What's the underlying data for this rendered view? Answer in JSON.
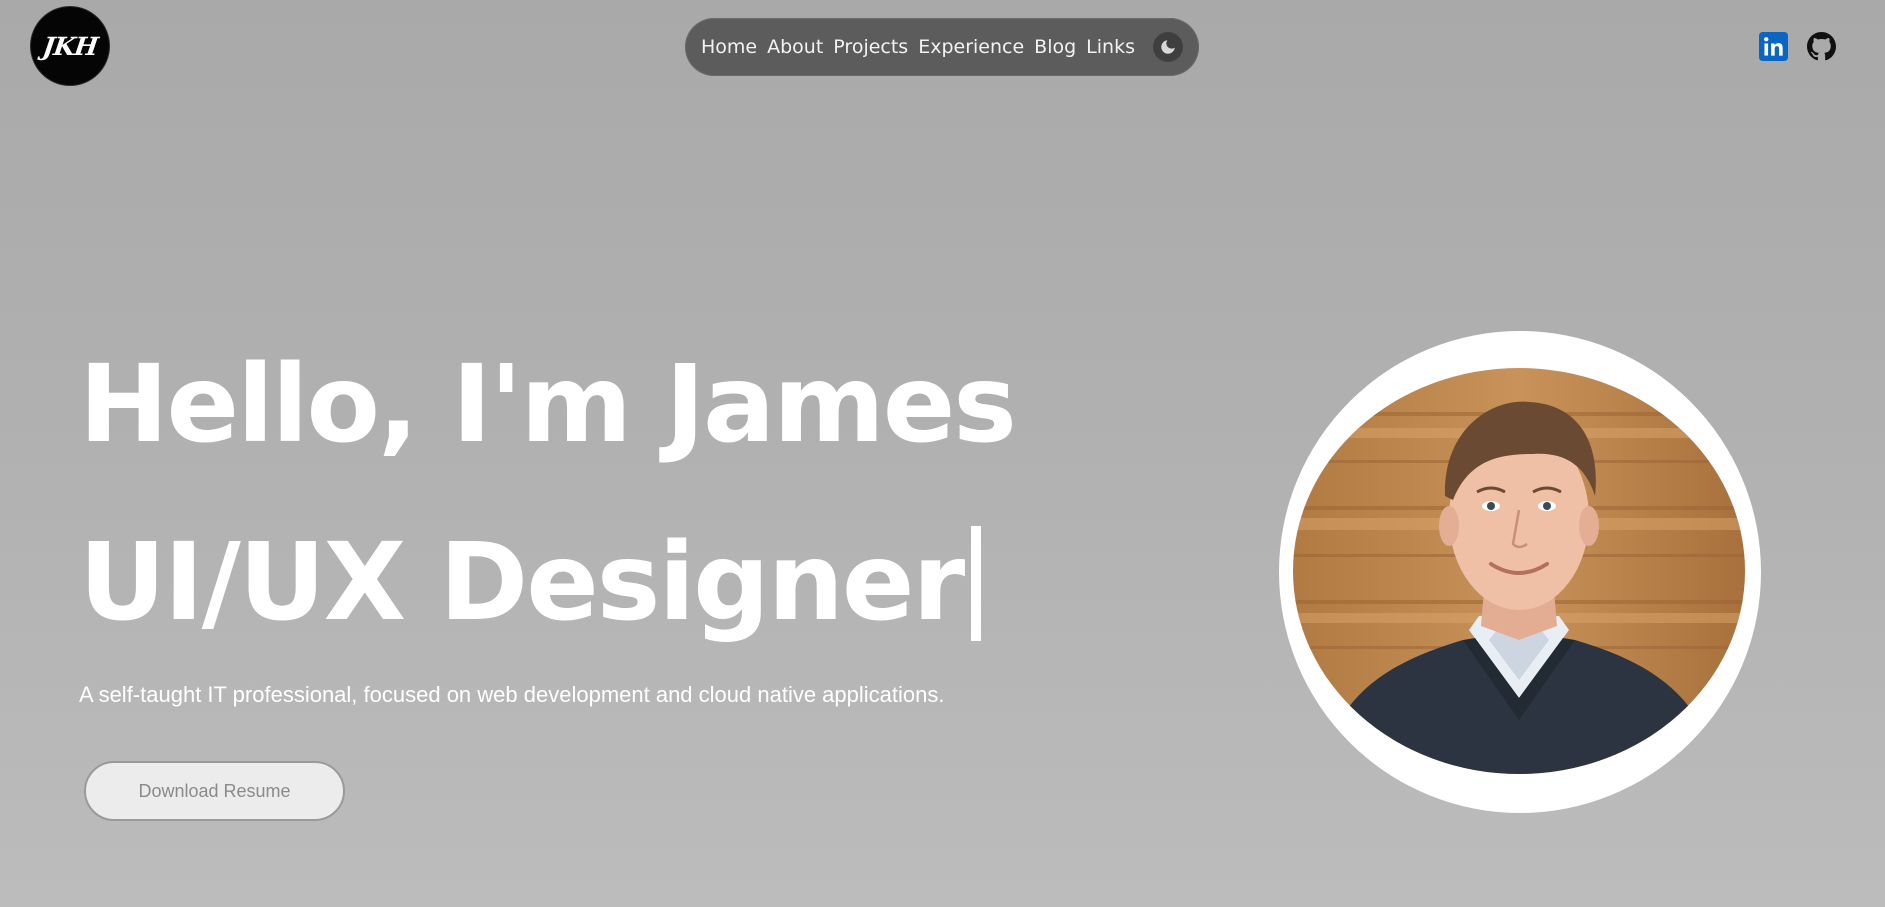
{
  "logo": {
    "text": "JKH"
  },
  "nav": {
    "items": [
      "Home",
      "About",
      "Projects",
      "Experience",
      "Blog",
      "Links"
    ],
    "theme_toggle_icon": "moon-icon"
  },
  "social": {
    "linkedin_icon": "linkedin-icon",
    "github_icon": "github-icon",
    "linkedin_color": "#0a66c2"
  },
  "hero": {
    "greeting": "Hello, I'm James",
    "role": "UI/UX Designer",
    "subtitle": "A self-taught IT professional, focused on web development and cloud native applications.",
    "resume_button": "Download Resume"
  },
  "colors": {
    "background": "#b0b0b0",
    "nav_background": "#5c5c5c",
    "text": "#ffffff"
  }
}
